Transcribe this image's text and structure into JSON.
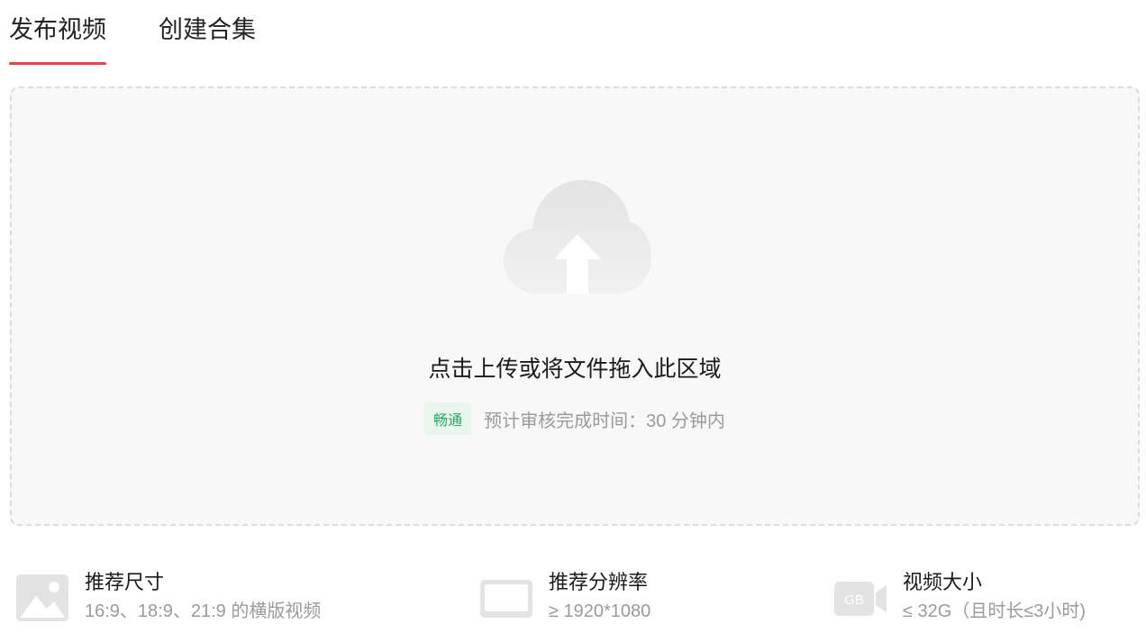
{
  "tabs": [
    {
      "label": "发布视频",
      "active": true
    },
    {
      "label": "创建合集",
      "active": false
    }
  ],
  "upload": {
    "title": "点击上传或将文件拖入此区域",
    "badge": "畅通",
    "estimate": "预计审核完成时间：30 分钟内",
    "icon": "cloud-upload-icon"
  },
  "specs": [
    {
      "icon": "image-icon",
      "title": "推荐尺寸",
      "desc": "16:9、18:9、21:9 的横版视频"
    },
    {
      "icon": "screen-icon",
      "title": "推荐分辨率",
      "desc": "≥ 1920*1080"
    },
    {
      "icon": "video-size-icon",
      "icon_text": "GB",
      "title": "视频大小",
      "desc": "≤ 32G（且时长≤3小时)"
    }
  ],
  "colors": {
    "accent": "#e8414a",
    "badge_text": "#28a860",
    "badge_bg": "#e8f6ee",
    "muted": "#9a9a9a"
  }
}
